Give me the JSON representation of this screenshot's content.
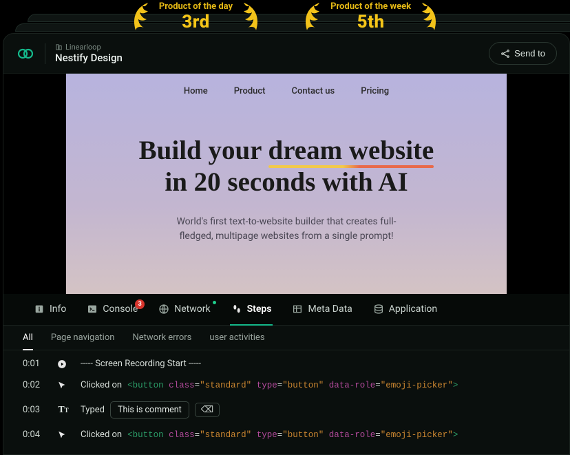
{
  "laurels": [
    {
      "label": "Product of the day",
      "rank": "3rd"
    },
    {
      "label": "Product of the week",
      "rank": "5th"
    }
  ],
  "header": {
    "org": "Linearloop",
    "title": "Nestify Design",
    "send_label": "Send to"
  },
  "preview": {
    "nav": [
      "Home",
      "Product",
      "Contact us",
      "Pricing"
    ],
    "hero_part1": "Build your ",
    "hero_underlined": "dream website",
    "hero_part2": "in 20 seconds with AI",
    "sub1": "World's first text-to-website builder that creates full-",
    "sub2": "fledged, multipage websites from a single prompt!"
  },
  "dev_tabs": {
    "info": "Info",
    "console": "Console",
    "console_badge": "3",
    "network": "Network",
    "steps": "Steps",
    "meta": "Meta Data",
    "application": "Application"
  },
  "sub_tabs": [
    "All",
    "Page navigation",
    "Network errors",
    "user activities"
  ],
  "steps": [
    {
      "time": "0:01",
      "kind": "record",
      "text": "-----  Screen Recording Start  -----"
    },
    {
      "time": "0:02",
      "kind": "click",
      "prefix": "Clicked on ",
      "tag_open": "<button",
      "attrs": [
        {
          "name": "class",
          "value": "\"standard\""
        },
        {
          "name": "type",
          "value": "\"button\""
        },
        {
          "name": "data-role",
          "value": "\"emoji-picker\""
        }
      ],
      "tag_close": ">"
    },
    {
      "time": "0:03",
      "kind": "type",
      "prefix": "Typed",
      "chip": "This is comment"
    },
    {
      "time": "0:04",
      "kind": "click",
      "prefix": "Clicked on ",
      "tag_open": "<button",
      "attrs": [
        {
          "name": "class",
          "value": "\"standard\""
        },
        {
          "name": "type",
          "value": "\"button\""
        },
        {
          "name": "data-role",
          "value": "\"emoji-picker\""
        }
      ],
      "tag_close": ">"
    }
  ]
}
